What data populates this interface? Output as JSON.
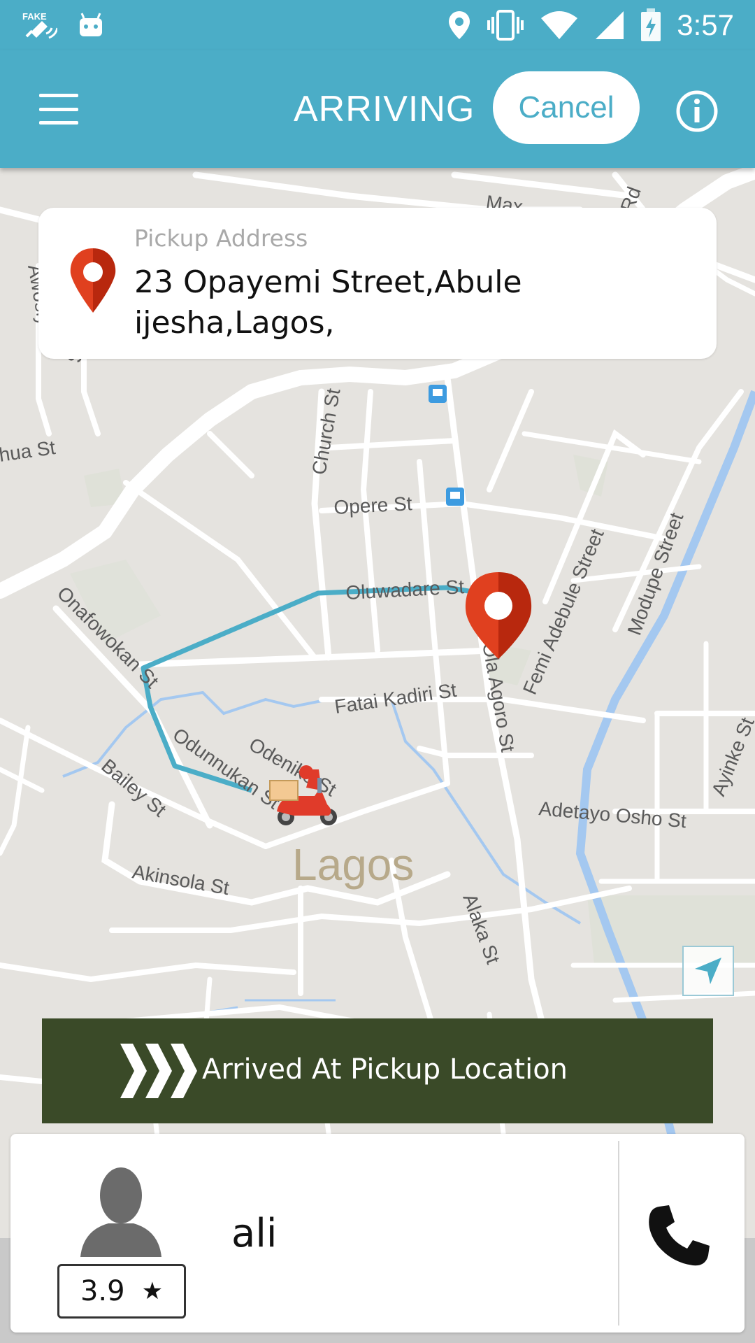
{
  "status_bar": {
    "time": "3:57",
    "icons": [
      "fake-gps-icon",
      "android-icon",
      "location-icon",
      "vibrate-icon",
      "wifi-icon",
      "signal-icon",
      "battery-charging-icon"
    ]
  },
  "app_bar": {
    "title": "ARRIVING",
    "cancel_label": "Cancel",
    "menu_icon": "hamburger-menu-icon",
    "info_icon": "info-icon"
  },
  "pickup": {
    "label": "Pickup Address",
    "address": "23 Opayemi Street,Abule ijesha,Lagos,"
  },
  "map": {
    "city_label": "Lagos",
    "street_labels": [
      "Oluwadare St",
      "Opere St",
      "Church St",
      "Fatai Kadiri St",
      "Onafowokan St",
      "Odunnukan St",
      "Odenike St",
      "Bailey St",
      "Akinsola St",
      "Alaka St",
      "Adetayo Osho St",
      "Femi Adebule Street",
      "Modupe Street",
      "Ola Agoro St",
      "Ayinke St",
      "hua St",
      "Awosiyi St",
      "St",
      "Max",
      "Rd"
    ],
    "route_color": "#4badc7",
    "destination_pin_color": "#e0401f",
    "water_color": "#a4c8f0"
  },
  "slide_action": {
    "label": "Arrived At Pickup Location",
    "color": "#3a4a28"
  },
  "driver": {
    "name": "ali",
    "rating": "3.9",
    "star": "★",
    "call_icon": "phone-icon"
  },
  "colors": {
    "primary": "#4badc7",
    "map_bg": "#e5e3df"
  }
}
